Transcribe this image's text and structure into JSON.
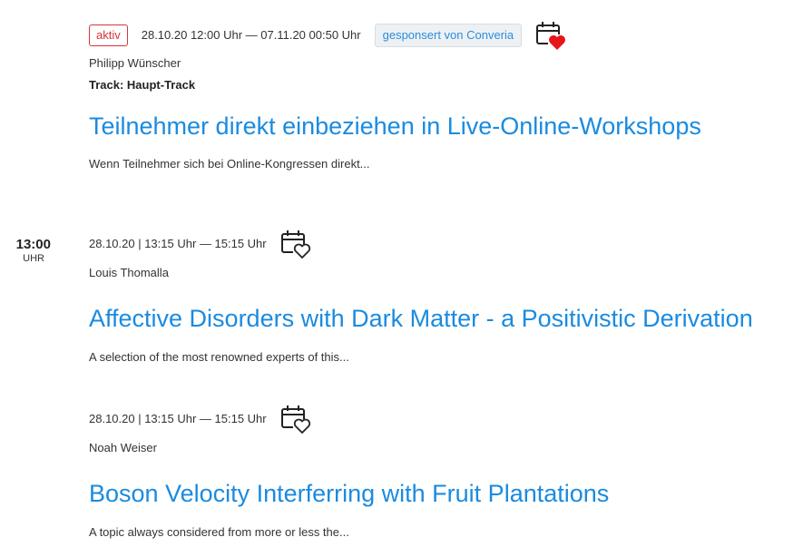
{
  "timeslot": {
    "time": "13:00",
    "unit": "UHR"
  },
  "sessions": [
    {
      "status": "aktiv",
      "date": "28.10.20 12:00 Uhr — 07.11.20 00:50 Uhr",
      "sponsor": "gesponsert von Converia",
      "favorite_icon": "calendar-heart-filled-icon",
      "speaker": "Philipp Wünscher",
      "track": "Track: Haupt-Track",
      "title": "Teilnehmer direkt einbeziehen in Live-Online-Workshops",
      "teaser": "Wenn Teilnehmer sich bei Online-Kongressen direkt..."
    },
    {
      "date": "28.10.20 | 13:15 Uhr — 15:15 Uhr",
      "favorite_icon": "calendar-heart-outline-icon",
      "speaker": "Louis Thomalla",
      "title": "Affective Disorders with Dark Matter - a Positivistic Derivation",
      "teaser": "A selection of the most renowned experts of this..."
    },
    {
      "date": "28.10.20 | 13:15 Uhr — 15:15 Uhr",
      "favorite_icon": "calendar-heart-outline-icon",
      "speaker": "Noah Weiser",
      "title": "Boson Velocity Interferring with Fruit Plantations",
      "teaser": "A topic always considered from more or less the..."
    }
  ],
  "colors": {
    "link": "#1a8be0",
    "active": "#d9343a",
    "heart": "#e8141c",
    "sponsor_bg": "#eef1f4"
  }
}
